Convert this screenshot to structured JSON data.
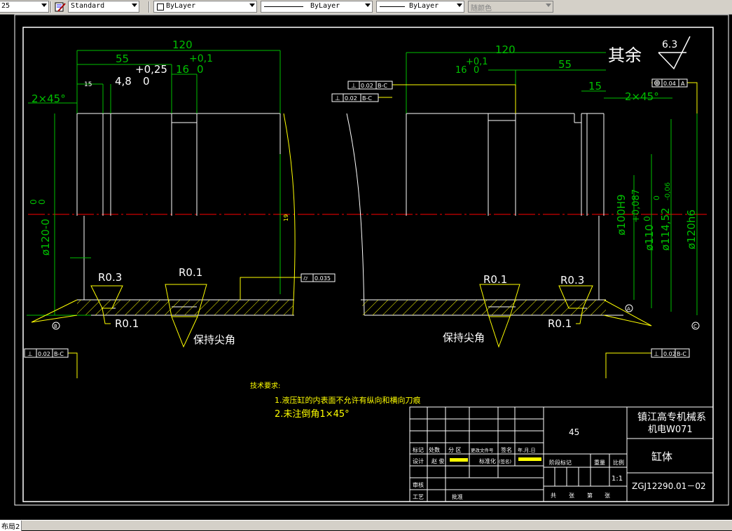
{
  "toolbar": {
    "dimstyle_value": "25",
    "textstyle_value": "Standard",
    "layer_value": "ByLayer",
    "linetype_value": "ByLayer",
    "lineweight_value": "ByLayer",
    "color_value": "随颜色"
  },
  "status": {
    "layout_tab": "布局2"
  },
  "drawing": {
    "roughness_label": "其余",
    "roughness_value": "6.3",
    "dims": {
      "len_120_left": "120",
      "len_55_left": "55",
      "tol_upper_left": "+0,1",
      "tol_025": "+0,25",
      "len_16_left": "16",
      "tol_zero_16_left": "0",
      "len_15_left": "15",
      "len_48": "4,8",
      "tol_zero_48": "0",
      "chamfer_left": "2×45°",
      "len_120_right": "120",
      "tol_upper_right": "+0,1",
      "len_16_right": "16",
      "tol_zero_16_right": "0",
      "len_55_right": "55",
      "len_15_right": "15",
      "chamfer_right": "2×45°",
      "dia_120_left": "ø120-0",
      "dia_120_left_tol_a": "0",
      "dia_120_left_tol_b": "0",
      "dia_100": "ø100H9",
      "dia_110": "ø110",
      "dia_110_tol_upper": "+0,087",
      "dia_110_tol_lower": "0",
      "dia_114": "ø114,52",
      "dia_114_tol_upper": "0",
      "dia_114_tol_lower": "-0,06",
      "dia_120_right": "ø120h6",
      "radius_03_left": "R0.3",
      "radius_01_left_top": "R0.1",
      "radius_01_left_bottom": "R0.1",
      "radius_01_right_top": "R0.1",
      "radius_03_right": "R0.3",
      "radius_01_right_bottom": "R0.1",
      "keep_sharp_left": "保持尖角",
      "keep_sharp_right": "保持尖角",
      "small_dim_19": "19"
    },
    "gdt": {
      "perp_top_1_val": "0.02",
      "perp_top_1_ref": "B-C",
      "perp_top_2_val": "0.02",
      "perp_top_2_ref": "B-C",
      "concentric_val": "0.04",
      "concentric_ref": "A",
      "cyl_val": "0.035",
      "perp_bl_val": "0.02",
      "perp_bl_ref": "B-C",
      "perp_br_val": "0.02",
      "perp_br_ref": "B-C",
      "datum_b": "B",
      "datum_a": "A",
      "datum_c": "C"
    },
    "notes": {
      "title": "技术要求:",
      "line1": "1.液压缸的内表面不允许有纵向和横向刀痕",
      "line2": "2.未注倒角1×45°"
    },
    "title_block": {
      "material": "45",
      "school_line1": "镇江高专机械系",
      "school_line2": "机电W071",
      "part_name": "缸体",
      "drawing_no": "ZGJ12290.01－02",
      "h_mark": "标记",
      "h_qty": "处数",
      "h_zone": "分  区",
      "h_docno": "更改文件号",
      "h_sign": "签名",
      "h_date": "年.月.日",
      "h_design": "设计",
      "designer": "赵  俊",
      "h_std": "标准化",
      "h_sign2": "(签名)",
      "h_stage": "阶段标记",
      "h_weight": "重量",
      "h_scale": "比例",
      "scale": "1:1",
      "h_review": "审核",
      "h_craft": "工艺",
      "h_approve": "批准",
      "h_total": "共",
      "h_sheets": "张",
      "h_num": "第",
      "h_sheet2": "张"
    }
  },
  "colors": {
    "background": "#000000",
    "white": "#ffffff",
    "yellow": "#ffff00",
    "green": "#00c000",
    "red": "#ff0000"
  }
}
